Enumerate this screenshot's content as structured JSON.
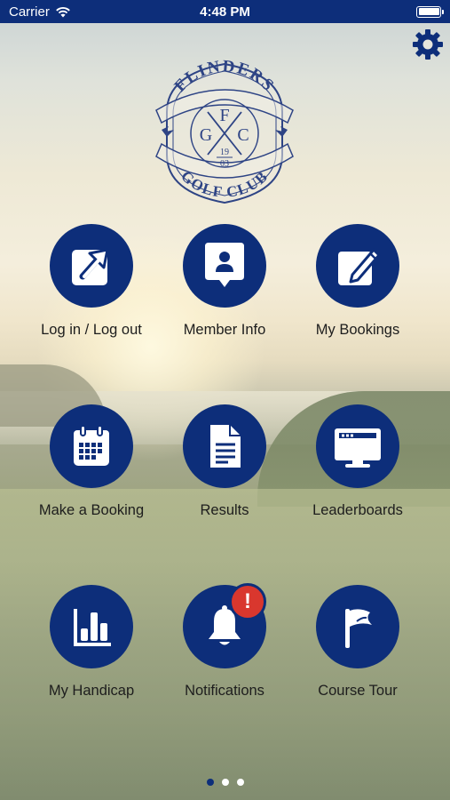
{
  "status_bar": {
    "carrier": "Carrier",
    "time": "4:48 PM",
    "battery_level": 1.0
  },
  "settings": {
    "icon": "gear-icon"
  },
  "logo": {
    "top_text": "FLINDERS",
    "bottom_text": "GOLF CLUB",
    "monogram": [
      "G",
      "F",
      "C"
    ],
    "year_top": "19",
    "year_bottom": "03"
  },
  "menu": [
    {
      "label": "Log in / Log out",
      "icon": "login-arrow-icon"
    },
    {
      "label": "Member Info",
      "icon": "member-card-icon"
    },
    {
      "label": "My Bookings",
      "icon": "edit-pencil-icon"
    },
    {
      "label": "Make a Booking",
      "icon": "calendar-icon"
    },
    {
      "label": "Results",
      "icon": "document-icon"
    },
    {
      "label": "Leaderboards",
      "icon": "monitor-icon"
    },
    {
      "label": "My Handicap",
      "icon": "bar-chart-icon"
    },
    {
      "label": "Notifications",
      "icon": "bell-icon",
      "badge": "!"
    },
    {
      "label": "Course Tour",
      "icon": "flag-icon"
    }
  ],
  "pager": {
    "pages": 3,
    "current": 1
  },
  "colors": {
    "brand": "#0d2e7a",
    "alert": "#d9372e"
  }
}
